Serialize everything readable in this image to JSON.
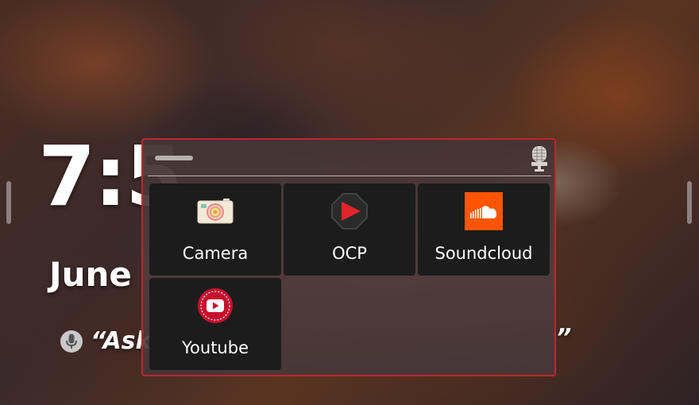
{
  "homescreen": {
    "time": "7:5",
    "date": "June",
    "hint_text": "“Ask",
    "hint_close": "”"
  },
  "app_drawer": {
    "apps": [
      {
        "label": "Camera",
        "icon": "camera-icon"
      },
      {
        "label": "OCP",
        "icon": "ocp-play-icon"
      },
      {
        "label": "Soundcloud",
        "icon": "soundcloud-icon"
      },
      {
        "label": "Youtube",
        "icon": "youtube-icon"
      }
    ],
    "mic_icon": "microphone-icon"
  },
  "colors": {
    "drawer_border": "#c0262d",
    "tile_bg": "#1c1c1c",
    "soundcloud_orange": "#ff5500",
    "youtube_red": "#c8102e"
  }
}
